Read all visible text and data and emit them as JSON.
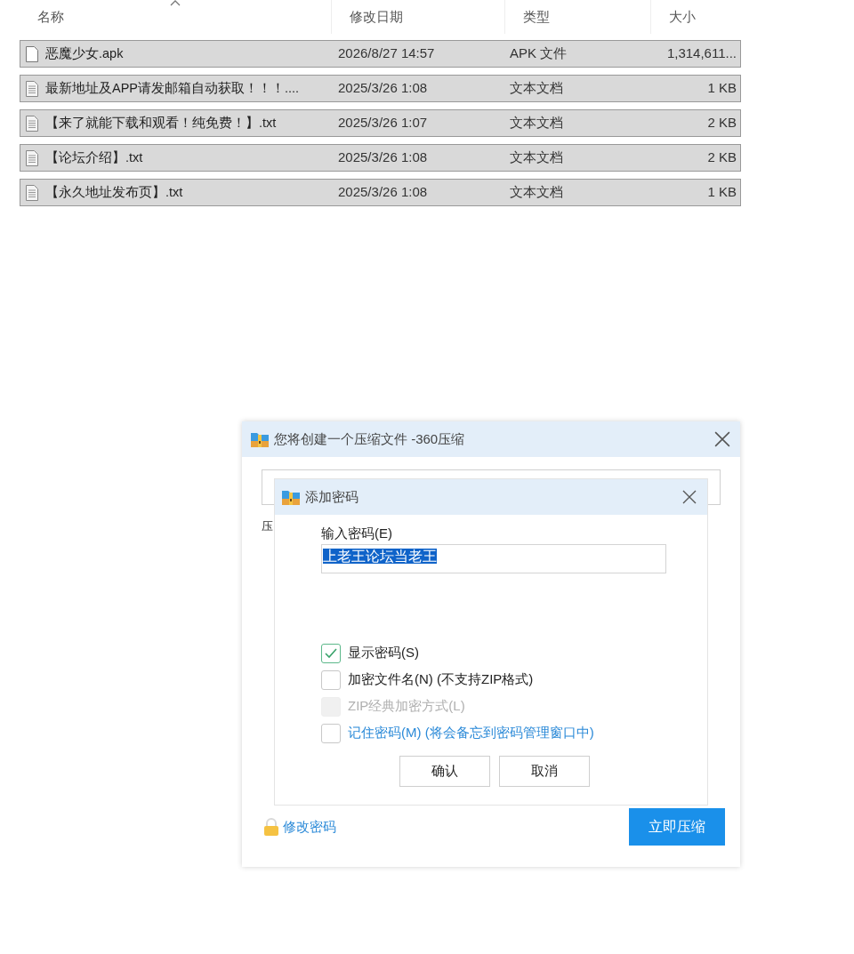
{
  "file_list": {
    "columns": [
      {
        "label": "名称",
        "sorted": true
      },
      {
        "label": "修改日期",
        "sorted": false
      },
      {
        "label": "类型",
        "sorted": false
      },
      {
        "label": "大小",
        "sorted": false
      }
    ],
    "rows": [
      {
        "kind": "apk",
        "name": "恶魔少女.apk",
        "modified": "2026/8/27 14:57",
        "type": "APK 文件",
        "size": "1,314,611...",
        "selected": true
      },
      {
        "kind": "text",
        "name": "最新地址及APP请发邮箱自动获取！！！....",
        "modified": "2025/3/26 1:08",
        "type": "文本文档",
        "size": "1 KB",
        "selected": true
      },
      {
        "kind": "text",
        "name": "【来了就能下载和观看！纯免费！】.txt",
        "modified": "2025/3/26 1:07",
        "type": "文本文档",
        "size": "2 KB",
        "selected": true
      },
      {
        "kind": "text",
        "name": "【论坛介绍】.txt",
        "modified": "2025/3/26 1:08",
        "type": "文本文档",
        "size": "2 KB",
        "selected": true
      },
      {
        "kind": "text",
        "name": "【永久地址发布页】.txt",
        "modified": "2025/3/26 1:08",
        "type": "文本文档",
        "size": "1 KB",
        "selected": true
      }
    ]
  },
  "compress_dialog": {
    "title": "您将创建一个压缩文件 -360压缩",
    "label": "压",
    "change_password_link": "修改密码",
    "compress_button": "立即压缩"
  },
  "password_dialog": {
    "title": "添加密码",
    "password_label": "输入密码(E)",
    "password_value": "上老王论坛当老王",
    "options": [
      {
        "kind": "plain",
        "label": "显示密码(S)",
        "checked": true,
        "disabled": false
      },
      {
        "kind": "plain",
        "label": "加密文件名(N) (不支持ZIP格式)",
        "checked": false,
        "disabled": false
      },
      {
        "kind": "plain",
        "label": "ZIP经典加密方式(L)",
        "checked": false,
        "disabled": true
      },
      {
        "kind": "link",
        "label": "记住密码(M) (将会备忘到密码管理窗口中)",
        "checked": false,
        "disabled": false
      }
    ],
    "buttons": [
      "确认",
      "取消"
    ]
  }
}
